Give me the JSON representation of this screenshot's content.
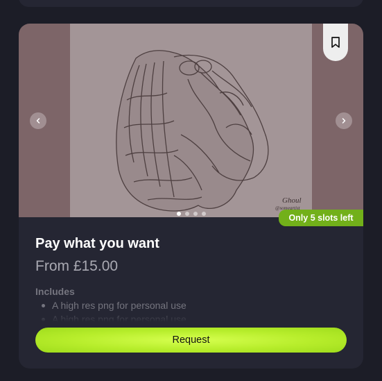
{
  "listing": {
    "title": "Pay what you want",
    "price": "From £15.00",
    "slots_badge": "Only 5 slots left",
    "includes_heading": "Includes",
    "includes": [
      "A high res png for personal use",
      "A high res png for personal use"
    ],
    "request_label": "Request",
    "image_alt": "Ghoul",
    "carousel": {
      "total_slides": 4,
      "active_slide": 1
    }
  },
  "icons": {
    "prev": "chevron-left-icon",
    "next": "chevron-right-icon",
    "bookmark": "bookmark-icon"
  },
  "colors": {
    "page_bg": "#1c1d27",
    "card_bg": "#252633",
    "accent": "#b7ed2b",
    "badge": "#72b01a"
  }
}
